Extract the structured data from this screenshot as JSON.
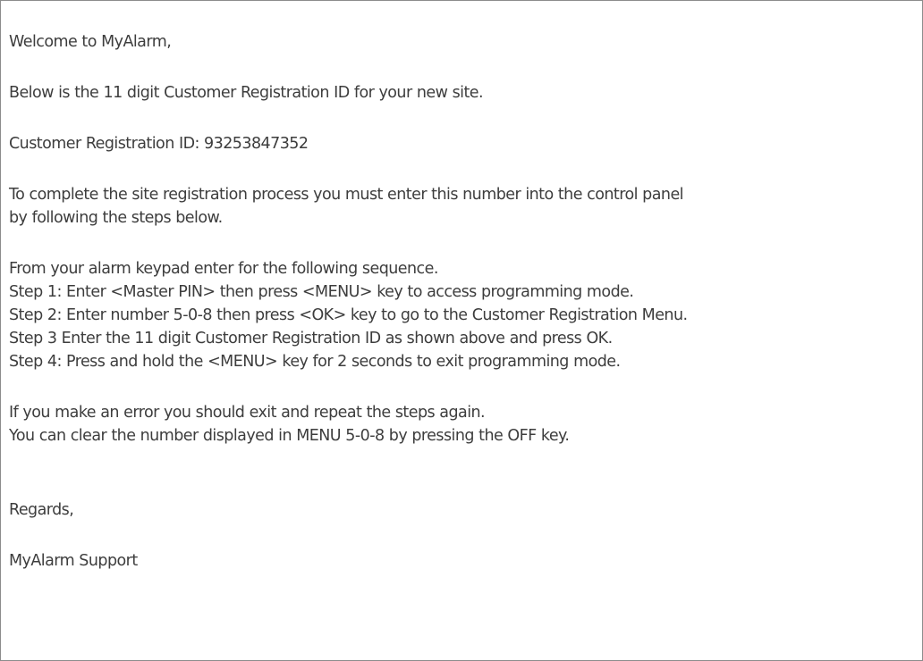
{
  "email": {
    "greeting": "Welcome to MyAlarm,",
    "intro": "Below is the 11 digit Customer Registration ID for your new site.",
    "registration_id_line": "Customer Registration ID: 93253847352",
    "instruction_line1": "To complete the site registration process you must enter this number into the control panel",
    "instruction_line2": "by following the steps below.",
    "sequence_intro": "From your alarm keypad enter for the following sequence.",
    "steps": [
      "Step 1: Enter <Master PIN> then press <MENU> key to access programming mode.",
      "Step 2: Enter number 5-0-8 then press  <OK> key to go to the Customer Registration Menu.",
      "Step 3  Enter the 11 digit Customer Registration ID as shown above and press OK.",
      "Step 4: Press and hold the <MENU> key for 2 seconds to exit programming mode."
    ],
    "error_line1": "If you make an error you should exit and repeat the steps again.",
    "error_line2": "You can clear the number displayed in MENU 5-0-8 by pressing the OFF key.",
    "closing": "Regards,",
    "signature": "MyAlarm Support"
  }
}
